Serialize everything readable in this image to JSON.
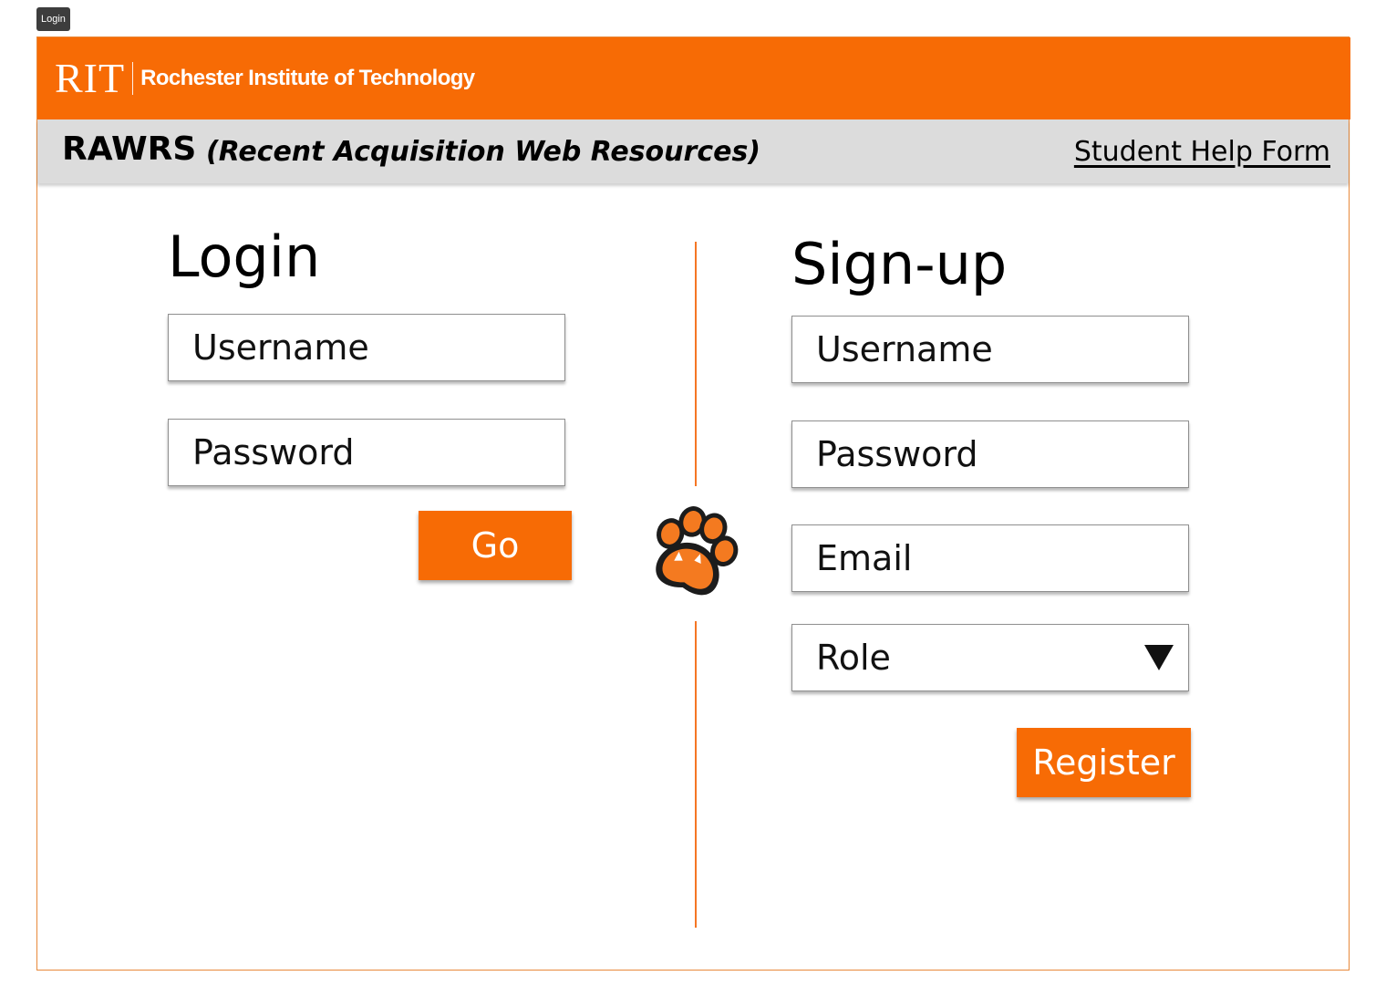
{
  "frame_tag": "Login",
  "header": {
    "logo_letters": "RIT",
    "institution": "Rochester Institute of Technology",
    "brand_color": "#f76b05"
  },
  "subheader": {
    "app_name": "RAWRS",
    "app_full_name": "(Recent Acquisition Web Resources)",
    "help_link": "Student Help Form"
  },
  "login": {
    "title": "Login",
    "username_placeholder": "Username",
    "password_placeholder": "Password",
    "submit_label": "Go"
  },
  "center_logo": {
    "icon": "tiger-paw-icon",
    "colors": {
      "orange": "#f47a20",
      "outline": "#1c1c1c"
    }
  },
  "signup": {
    "title": "Sign-up",
    "username_placeholder": "Username",
    "password_placeholder": "Password",
    "email_placeholder": "Email",
    "role_placeholder": "Role",
    "submit_label": "Register"
  }
}
